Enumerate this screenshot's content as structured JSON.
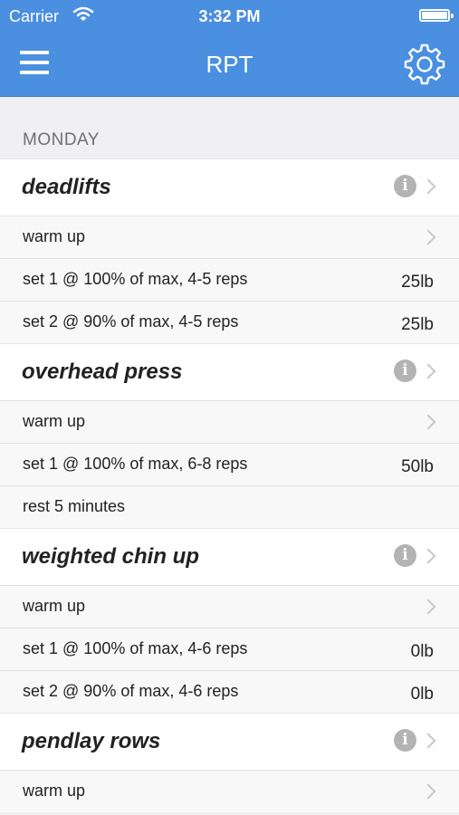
{
  "status": {
    "carrier": "Carrier",
    "time": "3:32 PM"
  },
  "nav": {
    "title": "RPT"
  },
  "section": {
    "label": "MONDAY"
  },
  "exercises": [
    {
      "name": "deadlifts",
      "rows": [
        {
          "text": "warm up",
          "weight": null
        },
        {
          "text": "set 1 @ 100% of max, 4-5 reps",
          "weight": "25lb"
        },
        {
          "text": "set 2 @ 90% of max, 4-5 reps",
          "weight": "25lb"
        }
      ]
    },
    {
      "name": "overhead press",
      "rows": [
        {
          "text": "warm up",
          "weight": null
        },
        {
          "text": "set 1 @ 100% of max, 6-8 reps",
          "weight": "50lb"
        },
        {
          "text": "rest 5 minutes",
          "weight": null
        }
      ]
    },
    {
      "name": "weighted chin up",
      "rows": [
        {
          "text": "warm up",
          "weight": null
        },
        {
          "text": "set 1 @ 100% of max, 4-6 reps",
          "weight": "0lb"
        },
        {
          "text": "set 2 @ 90% of max, 4-6 reps",
          "weight": "0lb"
        }
      ]
    },
    {
      "name": "pendlay rows",
      "rows": [
        {
          "text": "warm up",
          "weight": null
        }
      ]
    }
  ],
  "icons": {
    "info": "i",
    "menu": "hamburger-icon",
    "settings": "gear-icon",
    "disclosure": "chevron-right-icon"
  },
  "colors": {
    "nav": "#4a8fe0",
    "background": "#efeff4"
  }
}
